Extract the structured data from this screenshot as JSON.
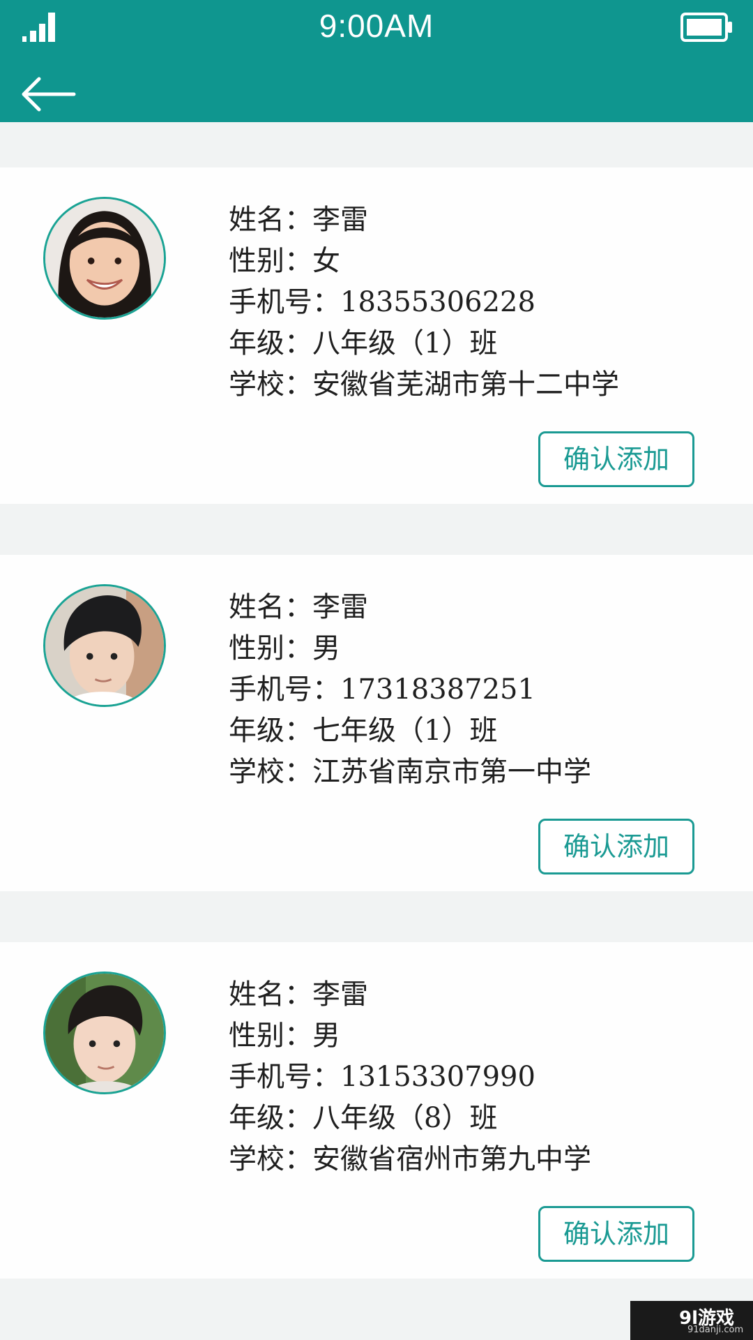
{
  "status": {
    "time": "9:00AM"
  },
  "header": {
    "back_icon": "arrow-left-icon"
  },
  "students": [
    {
      "name_label": "姓名：",
      "name": "李雷",
      "gender_label": "性别：",
      "gender": "女",
      "phone_label": "手机号：",
      "phone": "18355306228",
      "grade_label": "年级：",
      "grade": "八年级（1）班",
      "school_label": "学校：",
      "school": "安徽省芜湖市第十二中学",
      "button_label": "确认添加"
    },
    {
      "name_label": "姓名：",
      "name": "李雷",
      "gender_label": "性别：",
      "gender": "男",
      "phone_label": "手机号：",
      "phone": "17318387251",
      "grade_label": "年级：",
      "grade": "七年级（1）班",
      "school_label": "学校：",
      "school": "江苏省南京市第一中学",
      "button_label": "确认添加"
    },
    {
      "name_label": "姓名：",
      "name": "李雷",
      "gender_label": "性别：",
      "gender": "男",
      "phone_label": "手机号：",
      "phone": "13153307990",
      "grade_label": "年级：",
      "grade": "八年级（8）班",
      "school_label": "学校：",
      "school": "安徽省宿州市第九中学",
      "button_label": "确认添加"
    }
  ],
  "watermark": {
    "main": "9l游戏",
    "sub": "91danji.com"
  },
  "colors": {
    "header": "#0f968f",
    "accent": "#1a9a93",
    "background": "#f1f3f3"
  }
}
